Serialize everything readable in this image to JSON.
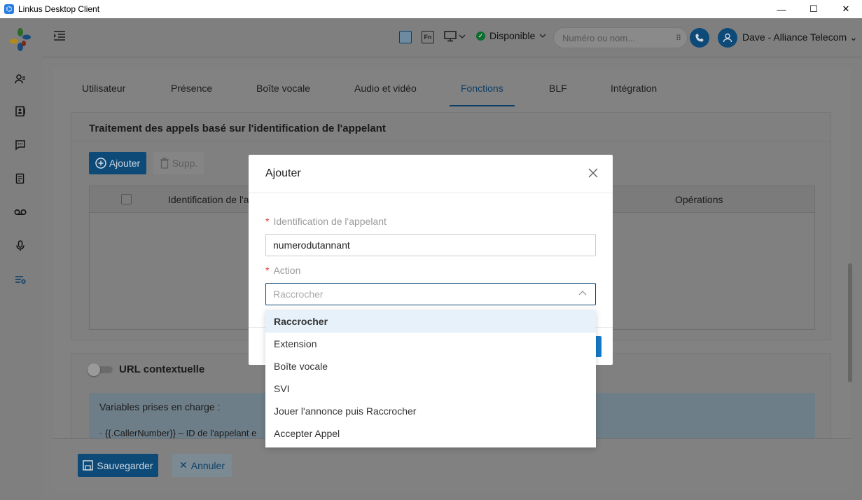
{
  "window": {
    "title": "Linkus Desktop Client",
    "controls": [
      "minimize",
      "maximize",
      "close"
    ]
  },
  "sidebar": {
    "icons": [
      "contacts-icon",
      "address-book-icon",
      "chat-icon",
      "call-log-icon",
      "voicemail-icon",
      "recording-icon",
      "settings-icon"
    ]
  },
  "header": {
    "presence": "Disponible",
    "search_placeholder": "Numéro ou nom...",
    "user_name": "Dave - Alliance Telecom",
    "fn_label": "Fn"
  },
  "tabs": [
    {
      "label": "Utilisateur",
      "active": false
    },
    {
      "label": "Présence",
      "active": false
    },
    {
      "label": "Boîte vocale",
      "active": false
    },
    {
      "label": "Audio et vidéo",
      "active": false
    },
    {
      "label": "Fonctions",
      "active": true
    },
    {
      "label": "BLF",
      "active": false
    },
    {
      "label": "Intégration",
      "active": false
    }
  ],
  "caller_id_section": {
    "title": "Traitement des appels basé sur l'identification de l'appelant",
    "add_label": "Ajouter",
    "delete_label": "Supp.",
    "table_headers": [
      "Identification de l'a",
      "Opérations"
    ]
  },
  "url_section": {
    "title": "URL contextuelle",
    "vars_intro": "Variables prises en charge :",
    "vars_line": "· {{.CallerNumber}} – ID de l'appelant e"
  },
  "footer": {
    "save_label": "Sauvegarder",
    "cancel_label": "Annuler"
  },
  "modal": {
    "title": "Ajouter",
    "caller_id_label": "Identification de l'appelant",
    "caller_id_value": "numerodutannant",
    "action_label": "Action",
    "action_placeholder": "Raccrocher",
    "required_mark": "*"
  },
  "dropdown": {
    "options": [
      {
        "label": "Raccrocher",
        "selected": true
      },
      {
        "label": "Extension",
        "selected": false
      },
      {
        "label": "Boîte vocale",
        "selected": false
      },
      {
        "label": "SVI",
        "selected": false
      },
      {
        "label": "Jouer l'annonce puis Raccrocher",
        "selected": false
      },
      {
        "label": "Accepter Appel",
        "selected": false
      }
    ]
  },
  "colors": {
    "primary": "#0d4a78",
    "overlay": "#808080",
    "modal_bg": "#ffffff",
    "selected_option_bg": "#e6f1fa",
    "presence_green": "#0f6d2f",
    "required_red": "#e53935"
  }
}
